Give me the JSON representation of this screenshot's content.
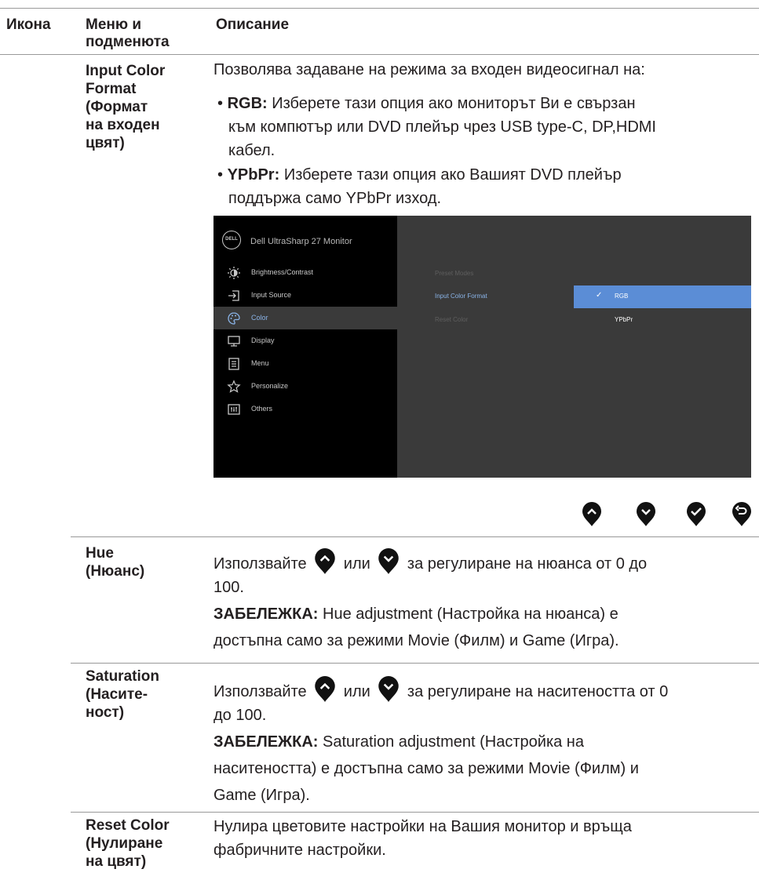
{
  "header": {
    "col_icon": "Икона",
    "col_menu_line1": "Меню и",
    "col_menu_line2": "подменюта",
    "col_desc": "Описание"
  },
  "input_color_format": {
    "menu_lines": [
      "Input Color",
      "Format",
      "(Формат",
      "на входен",
      "цвят)"
    ],
    "intro": "Позволява задаване на режима за входен видеосигнал на:",
    "rgb_label": "RGB:",
    "rgb_line1": "Изберете тази опция ако мониторът Ви е свързан",
    "rgb_line2": "към компютър или DVD плейър чрез USB type-C, DP,HDMI",
    "rgb_line3": "кабел.",
    "ypbpr_label": "YPbPr:",
    "ypbpr_line1": "Изберете тази опция ако Вашият DVD плейър",
    "ypbpr_line2": "поддържа само YPbPr изход."
  },
  "osd": {
    "logo": "DELL",
    "title": "Dell UltraSharp 27 Monitor",
    "menu": [
      {
        "label": "Brightness/Contrast",
        "icon": "brightness-icon"
      },
      {
        "label": "Input Source",
        "icon": "input-source-icon"
      },
      {
        "label": "Color",
        "icon": "color-palette-icon",
        "active": true
      },
      {
        "label": "Display",
        "icon": "display-icon"
      },
      {
        "label": "Menu",
        "icon": "menu-icon"
      },
      {
        "label": "Personalize",
        "icon": "star-icon"
      },
      {
        "label": "Others",
        "icon": "others-icon"
      }
    ],
    "submenu": [
      "Preset Modes",
      "Input Color Format",
      "Reset Color"
    ],
    "options": [
      "RGB",
      "YPbPr"
    ],
    "selected_option": "RGB",
    "colors": {
      "background": "#3a3a3a",
      "left_panel": "#000000",
      "highlight": "#5b8dd6"
    }
  },
  "buttons": [
    "up-button-icon",
    "down-button-icon",
    "ok-button-icon",
    "back-button-icon"
  ],
  "hue": {
    "menu_line1": "Hue",
    "menu_line2": "(Нюанс)",
    "use": "Използвайте",
    "or": "или",
    "text1": "за регулиране на нюанса от 0 до",
    "text2": "100.",
    "note_label": "ЗАБЕЛЕЖКА:",
    "note1": "Hue adjustment (Настройка на нюанса) е",
    "note2": "достъпна само за режими Movie (Филм) и Game (Игра)."
  },
  "saturation": {
    "menu_lines": [
      "Saturation",
      "(Насите-",
      "ност)"
    ],
    "use": "Използвайте",
    "or": "или",
    "text1": "за регулиране на наситеността от 0",
    "text2": "до 100.",
    "note_label": "ЗАБЕЛЕЖКА:",
    "note1": "Saturation adjustment (Настройка на",
    "note2": "наситеността) е достъпна само за режими Movie (Филм) и",
    "note3": "Game (Игра)."
  },
  "reset_color": {
    "menu_lines": [
      "Reset Color",
      "(Нулиране",
      "на цвят)"
    ],
    "text1": "Нулира цветовите настройки на Вашия монитор и връща",
    "text2": "фабричните настройки."
  }
}
